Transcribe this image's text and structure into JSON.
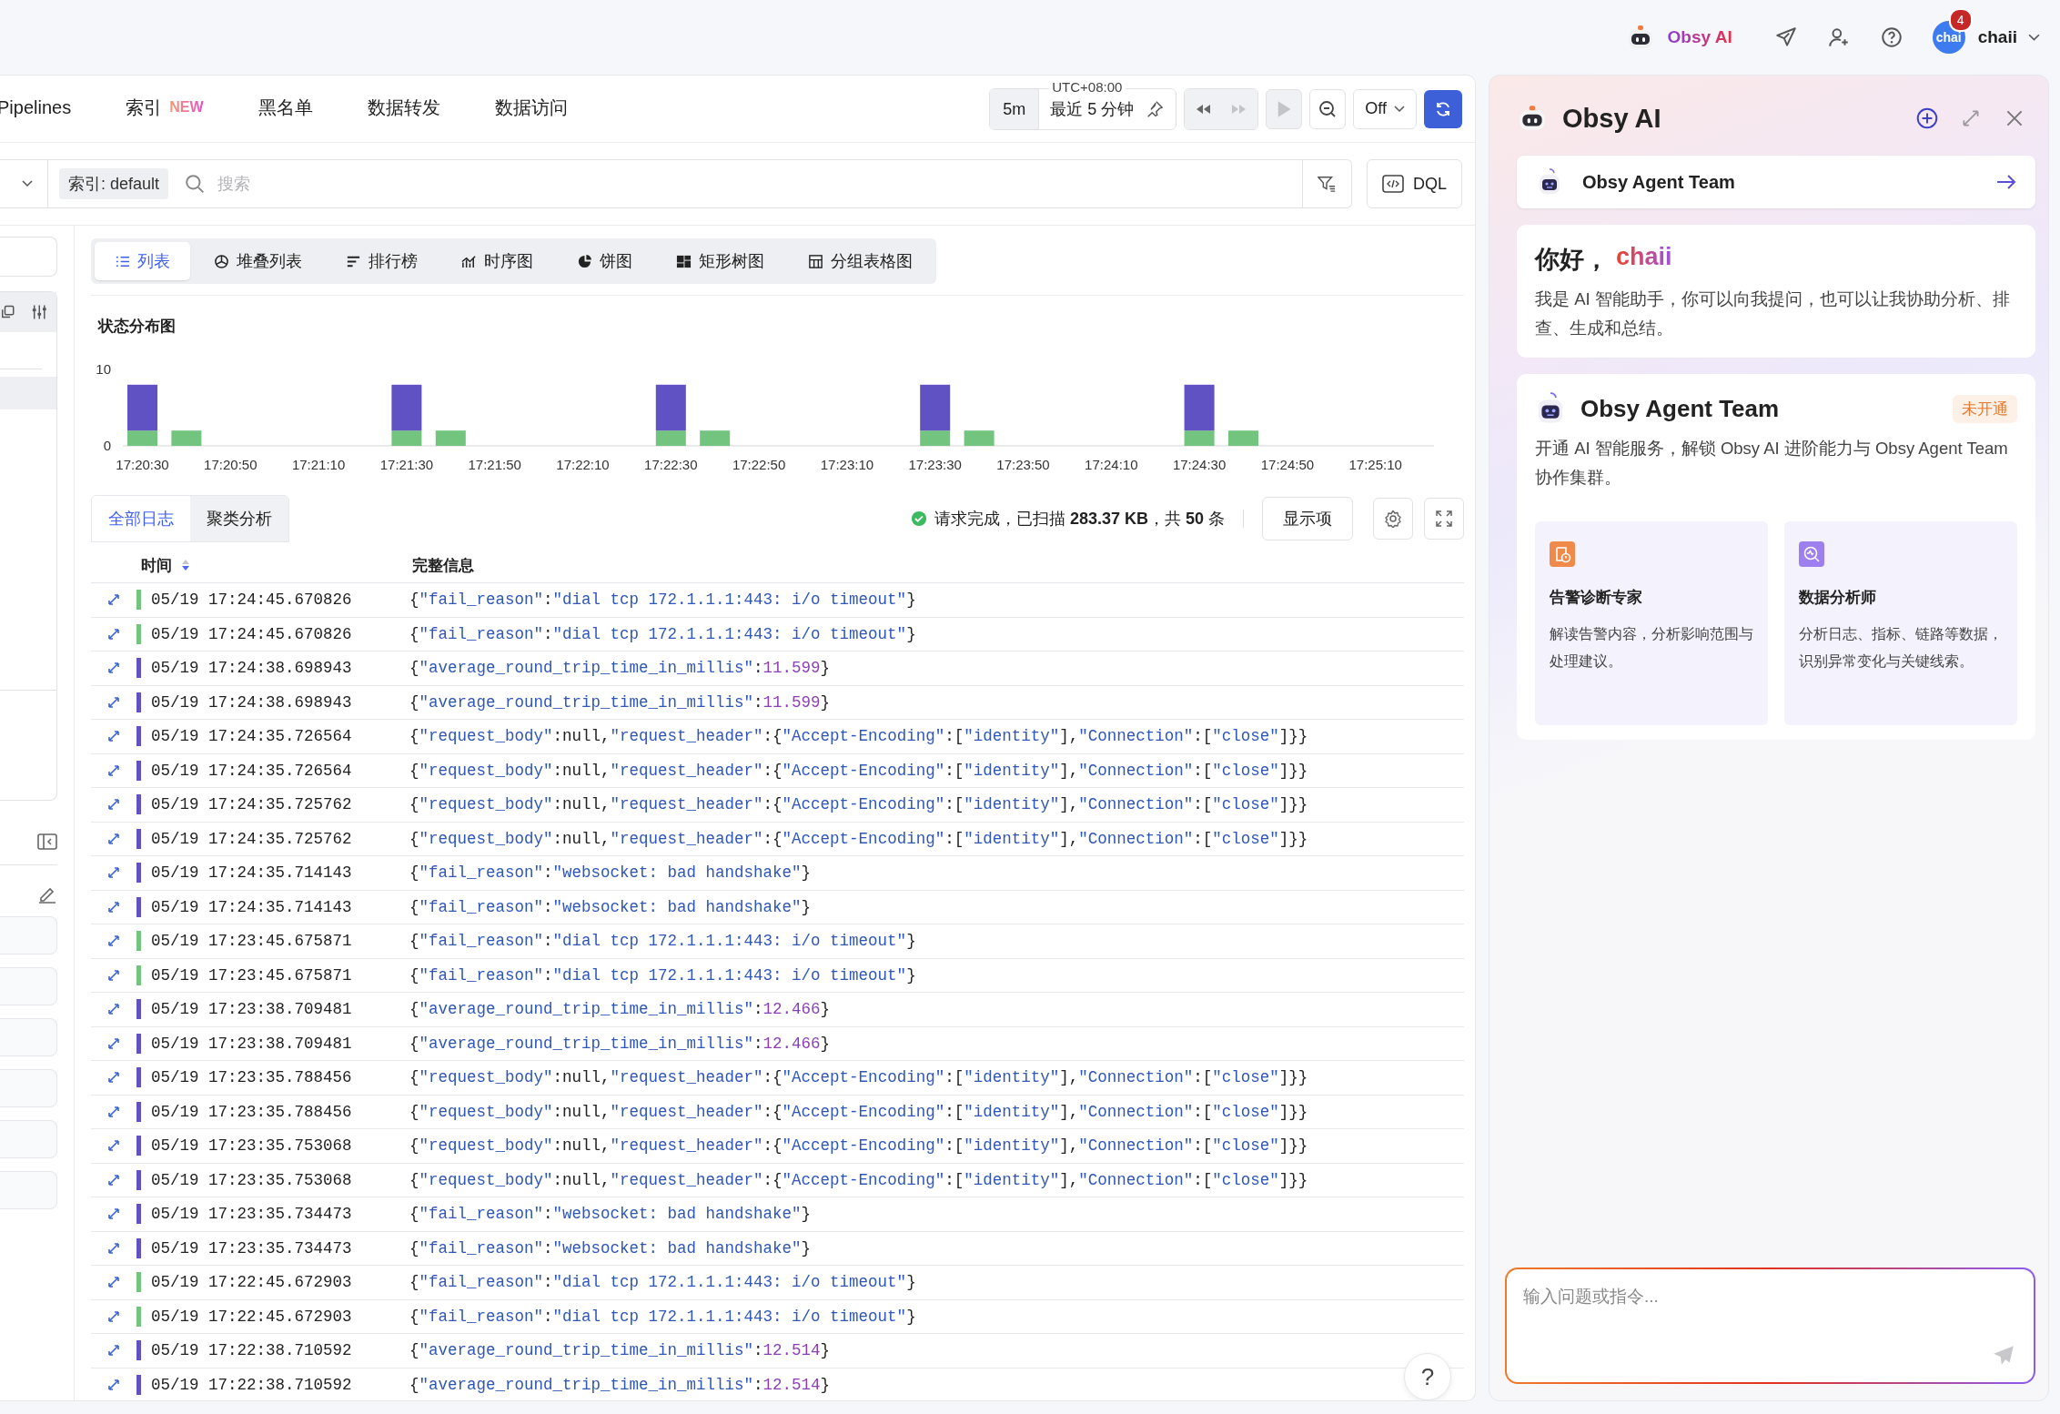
{
  "top_bar": {
    "assistant_label": "Obsy AI",
    "notification_count": "4",
    "avatar_text": "chai",
    "user_name": "chaii"
  },
  "nav_tabs": [
    {
      "label": "Pipelines",
      "selected": false
    },
    {
      "label": "索引",
      "badge": "NEW",
      "selected": false
    },
    {
      "label": "黑名单",
      "selected": false
    },
    {
      "label": "数据转发",
      "selected": false
    },
    {
      "label": "数据访问",
      "selected": false
    }
  ],
  "time_controls": {
    "interval": "5m",
    "timezone": "UTC+08:00",
    "range": "最近 5 分钟",
    "forward_disabled": true,
    "play_disabled": true,
    "auto_refresh": "Off"
  },
  "query_bar": {
    "index_tag": "索引: default",
    "placeholder": "搜索",
    "dql_button": "DQL"
  },
  "view_tabs": [
    {
      "label": "列表",
      "kind": "list",
      "selected": true
    },
    {
      "label": "堆叠列表",
      "kind": "stack",
      "selected": false
    },
    {
      "label": "排行榜",
      "kind": "rank",
      "selected": false
    },
    {
      "label": "时序图",
      "kind": "timeseries",
      "selected": false
    },
    {
      "label": "饼图",
      "kind": "pie",
      "selected": false
    },
    {
      "label": "矩形树图",
      "kind": "treemap",
      "selected": false
    },
    {
      "label": "分组表格图",
      "kind": "table",
      "selected": false
    }
  ],
  "chart": {
    "title": "状态分布图",
    "chart_data": {
      "type": "bar",
      "stacked": true,
      "categories": [
        "17:20:30",
        null,
        "17:20:50",
        null,
        "17:21:10",
        null,
        "17:21:30",
        null,
        "17:21:50",
        null,
        "17:22:10",
        null,
        "17:22:30",
        null,
        "17:22:50",
        null,
        "17:23:10",
        null,
        "17:23:30",
        null,
        "17:23:50",
        null,
        "17:24:10",
        null,
        "17:24:30",
        null,
        "17:24:50",
        null,
        "17:25:10"
      ],
      "series": [
        {
          "color": "#72c47e",
          "values": [
            2,
            2,
            0,
            0,
            0,
            0,
            2,
            2,
            0,
            0,
            0,
            0,
            2,
            2,
            0,
            0,
            0,
            0,
            2,
            2,
            0,
            0,
            0,
            0,
            2,
            2,
            0,
            0,
            0
          ]
        },
        {
          "color": "#6152c4",
          "values": [
            6,
            0,
            0,
            0,
            0,
            0,
            6,
            0,
            0,
            0,
            0,
            0,
            6,
            0,
            0,
            0,
            0,
            0,
            6,
            0,
            0,
            0,
            0,
            0,
            6,
            0,
            0,
            0,
            0
          ]
        }
      ],
      "ylim": [
        0,
        10
      ],
      "yticks": [
        0,
        10
      ]
    }
  },
  "log_tabs": [
    {
      "label": "全部日志",
      "selected": true
    },
    {
      "label": "聚类分析",
      "selected": false
    }
  ],
  "status": {
    "text": "请求完成，已扫描 **283.37 KB**，共 **50** 条",
    "display_button": "显示项"
  },
  "table": {
    "columns": [
      {
        "label": "时间",
        "sorted": true
      },
      {
        "label": "完整信息",
        "sorted": false
      }
    ],
    "rows": [
      {
        "time": "05/19 17:24:45.670826",
        "message": "{\"fail_reason\":\"dial tcp 172.1.1.1:443: i/o timeout\"}",
        "color": "#72c47e"
      },
      {
        "time": "05/19 17:24:45.670826",
        "message": "{\"fail_reason\":\"dial tcp 172.1.1.1:443: i/o timeout\"}",
        "color": "#72c47e"
      },
      {
        "time": "05/19 17:24:38.698943",
        "message": "{\"average_round_trip_time_in_millis\":11.599}",
        "color": "#6152c4"
      },
      {
        "time": "05/19 17:24:38.698943",
        "message": "{\"average_round_trip_time_in_millis\":11.599}",
        "color": "#6152c4"
      },
      {
        "time": "05/19 17:24:35.726564",
        "message": "{\"request_body\":null,\"request_header\":{\"Accept-Encoding\":[\"identity\"],\"Connection\":[\"close\"]}}",
        "color": "#6152c4"
      },
      {
        "time": "05/19 17:24:35.726564",
        "message": "{\"request_body\":null,\"request_header\":{\"Accept-Encoding\":[\"identity\"],\"Connection\":[\"close\"]}}",
        "color": "#6152c4"
      },
      {
        "time": "05/19 17:24:35.725762",
        "message": "{\"request_body\":null,\"request_header\":{\"Accept-Encoding\":[\"identity\"],\"Connection\":[\"close\"]}}",
        "color": "#6152c4"
      },
      {
        "time": "05/19 17:24:35.725762",
        "message": "{\"request_body\":null,\"request_header\":{\"Accept-Encoding\":[\"identity\"],\"Connection\":[\"close\"]}}",
        "color": "#6152c4"
      },
      {
        "time": "05/19 17:24:35.714143",
        "message": "{\"fail_reason\":\"websocket: bad handshake\"}",
        "color": "#6152c4"
      },
      {
        "time": "05/19 17:24:35.714143",
        "message": "{\"fail_reason\":\"websocket: bad handshake\"}",
        "color": "#6152c4"
      },
      {
        "time": "05/19 17:23:45.675871",
        "message": "{\"fail_reason\":\"dial tcp 172.1.1.1:443: i/o timeout\"}",
        "color": "#72c47e"
      },
      {
        "time": "05/19 17:23:45.675871",
        "message": "{\"fail_reason\":\"dial tcp 172.1.1.1:443: i/o timeout\"}",
        "color": "#72c47e"
      },
      {
        "time": "05/19 17:23:38.709481",
        "message": "{\"average_round_trip_time_in_millis\":12.466}",
        "color": "#6152c4"
      },
      {
        "time": "05/19 17:23:38.709481",
        "message": "{\"average_round_trip_time_in_millis\":12.466}",
        "color": "#6152c4"
      },
      {
        "time": "05/19 17:23:35.788456",
        "message": "{\"request_body\":null,\"request_header\":{\"Accept-Encoding\":[\"identity\"],\"Connection\":[\"close\"]}}",
        "color": "#6152c4"
      },
      {
        "time": "05/19 17:23:35.788456",
        "message": "{\"request_body\":null,\"request_header\":{\"Accept-Encoding\":[\"identity\"],\"Connection\":[\"close\"]}}",
        "color": "#6152c4"
      },
      {
        "time": "05/19 17:23:35.753068",
        "message": "{\"request_body\":null,\"request_header\":{\"Accept-Encoding\":[\"identity\"],\"Connection\":[\"close\"]}}",
        "color": "#6152c4"
      },
      {
        "time": "05/19 17:23:35.753068",
        "message": "{\"request_body\":null,\"request_header\":{\"Accept-Encoding\":[\"identity\"],\"Connection\":[\"close\"]}}",
        "color": "#6152c4"
      },
      {
        "time": "05/19 17:23:35.734473",
        "message": "{\"fail_reason\":\"websocket: bad handshake\"}",
        "color": "#6152c4"
      },
      {
        "time": "05/19 17:23:35.734473",
        "message": "{\"fail_reason\":\"websocket: bad handshake\"}",
        "color": "#6152c4"
      },
      {
        "time": "05/19 17:22:45.672903",
        "message": "{\"fail_reason\":\"dial tcp 172.1.1.1:443: i/o timeout\"}",
        "color": "#72c47e"
      },
      {
        "time": "05/19 17:22:45.672903",
        "message": "{\"fail_reason\":\"dial tcp 172.1.1.1:443: i/o timeout\"}",
        "color": "#72c47e"
      },
      {
        "time": "05/19 17:22:38.710592",
        "message": "{\"average_round_trip_time_in_millis\":12.514}",
        "color": "#6152c4"
      },
      {
        "time": "05/19 17:22:38.710592",
        "message": "{\"average_round_trip_time_in_millis\":12.514}",
        "color": "#6152c4"
      }
    ]
  },
  "help_button": "?",
  "ai_panel": {
    "title": "Obsy AI",
    "agent_link": "Obsy Agent Team",
    "greeting": "你好，",
    "user_name": "chaii",
    "intro": "我是 AI 智能助手，你可以向我提问，也可以让我协助分析、排查、生成和总结。",
    "agent_card": {
      "title": "Obsy Agent Team",
      "status": "未开通",
      "description": "开通 AI 智能服务，解锁 Obsy AI 进阶能力与 Obsy Agent Team 协作集群。",
      "agents": [
        {
          "kind": "alert",
          "title": "告警诊断专家",
          "description": "解读告警内容，分析影响范围与处理建议。"
        },
        {
          "kind": "analysis",
          "title": "数据分析师",
          "description": "分析日志、指标、链路等数据，识别异常变化与关键线索。"
        }
      ]
    },
    "input_placeholder": "输入问题或指令..."
  }
}
